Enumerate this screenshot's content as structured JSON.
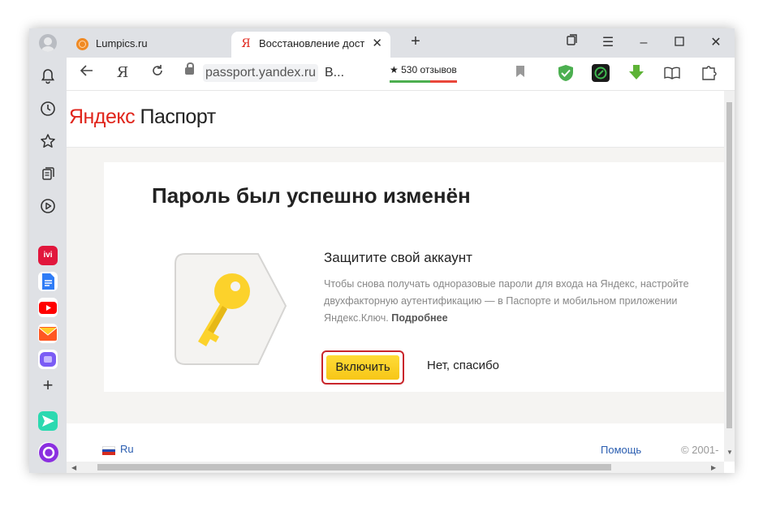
{
  "browser": {
    "tabs": [
      {
        "title": "Lumpics.ru"
      },
      {
        "title": "Восстановление досту",
        "favicon": "Я"
      }
    ],
    "new_tab": "+",
    "address": {
      "domain": "passport.yandex.ru",
      "page": "В..."
    },
    "reviews": "★ 530 отзывов",
    "yandex_button": "Я"
  },
  "page": {
    "logo_red": "Яндекс",
    "logo_black": " Паспорт",
    "title": "Пароль был успешно изменён",
    "subtitle": "Защитите свой аккаунт",
    "description": "Чтобы снова получать одноразовые пароли для входа на Яндекс, настройте двухфакторную аутентификацию — в Паспорте и мобильном приложении Яндекс.Ключ.",
    "more_link": "Подробнее",
    "enable_button": "Включить",
    "decline_link": "Нет, спасибо"
  },
  "footer": {
    "language": "Ru",
    "help": "Помощь",
    "copyright": "© 2001-"
  },
  "colors": {
    "accent_yellow": "#ffdc37",
    "yandex_red": "#e0261c",
    "highlight_border": "#c9262c"
  }
}
